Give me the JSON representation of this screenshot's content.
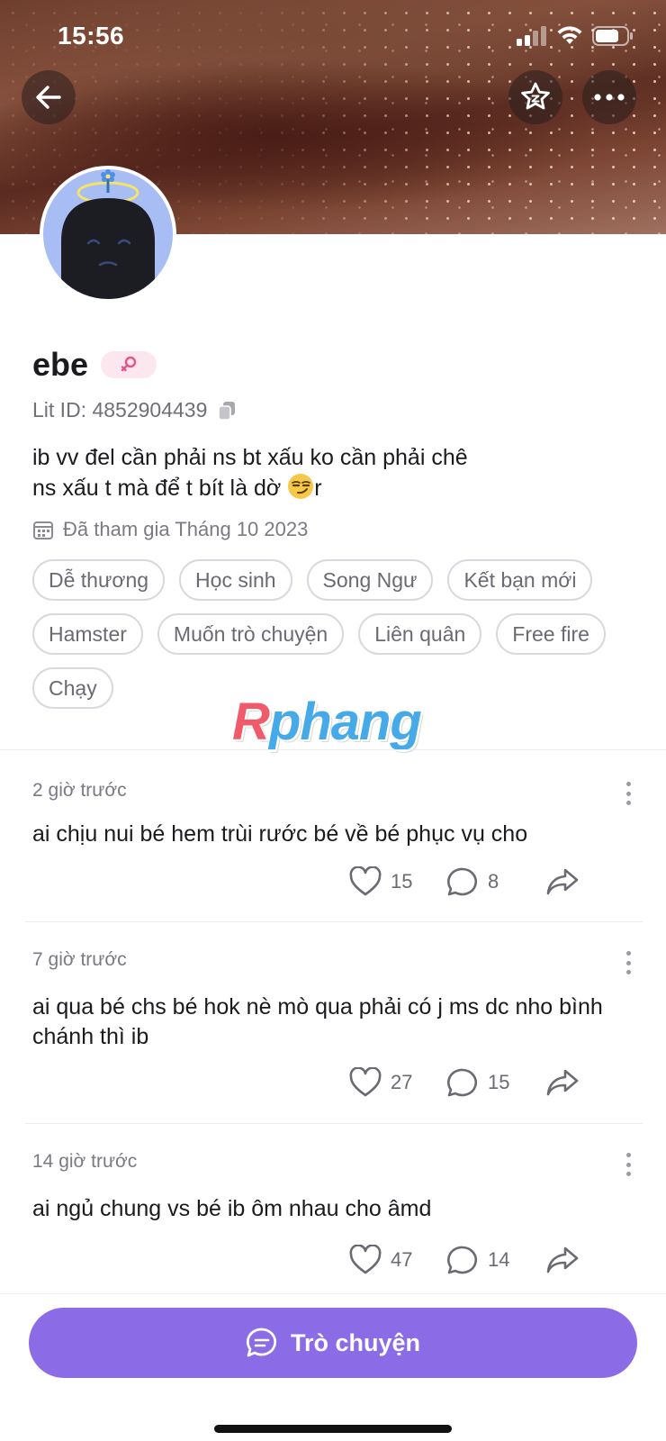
{
  "status_bar": {
    "time": "15:56"
  },
  "header": {
    "back_icon": "arrow-left-icon",
    "favorite_icon": "star-icon",
    "more_icon": "more-horizontal-icon"
  },
  "profile": {
    "name": "ebe",
    "gender_icon": "female-icon",
    "lit_id": "Lit ID: 4852904439",
    "bio_line1": "ib vv đel cần phải ns bt xấu ko cần phải chê",
    "bio_line2_before": "ns xấu t mà để t bít là dờ ",
    "bio_emoji": "😏",
    "bio_line2_after": "r",
    "joined": "Đã tham gia Tháng 10 2023",
    "tags": [
      "Dễ thương",
      "Học sinh",
      "Song Ngư",
      "Kết bạn mới",
      "Hamster",
      "Muốn trò chuyện",
      "Liên quân",
      "Free fire",
      "Chạy"
    ]
  },
  "watermark": {
    "first": "R",
    "rest": "phang"
  },
  "posts": [
    {
      "time": "2 giờ trước",
      "text": "ai chịu nui bé hem trùi rước bé về bé phục vụ cho",
      "likes": "15",
      "comments": "8"
    },
    {
      "time": "7 giờ trước",
      "text": "ai qua bé chs bé hok nè mò qua phải có j ms dc nho bình chánh thì ib",
      "likes": "27",
      "comments": "15"
    },
    {
      "time": "14 giờ trước",
      "text": "ai ngủ chung vs bé ib ôm nhau cho âmd",
      "likes": "47",
      "comments": "14"
    }
  ],
  "chat_button": {
    "label": "Trò chuyện"
  },
  "colors": {
    "accent": "#8b6ce6",
    "avatar_bg": "#a9bdf5",
    "gender_badge": "#fde7ef"
  }
}
